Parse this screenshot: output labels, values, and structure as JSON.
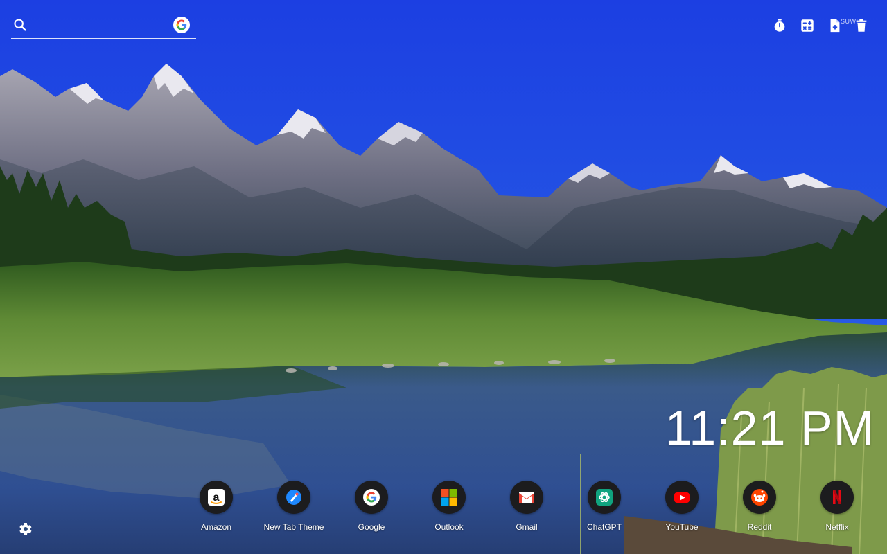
{
  "search": {
    "value": "",
    "placeholder": "",
    "engine_icon": "google-g-icon"
  },
  "tools": [
    {
      "name": "timer-icon",
      "label": "Timer"
    },
    {
      "name": "calculator-icon",
      "label": "Calculator"
    },
    {
      "name": "new-note-icon",
      "label": "New note"
    },
    {
      "name": "trash-icon",
      "label": "Trash"
    }
  ],
  "tool_tag": "SUWI",
  "clock": {
    "time": "11:21 PM"
  },
  "shortcuts": [
    {
      "label": "Amazon",
      "icon": "amazon-icon"
    },
    {
      "label": "New Tab Theme",
      "icon": "new-tab-theme-icon"
    },
    {
      "label": "Google",
      "icon": "google-icon"
    },
    {
      "label": "Outlook",
      "icon": "outlook-icon"
    },
    {
      "label": "Gmail",
      "icon": "gmail-icon"
    },
    {
      "label": "ChatGPT",
      "icon": "chatgpt-icon"
    },
    {
      "label": "YouTube",
      "icon": "youtube-icon"
    },
    {
      "label": "Reddit",
      "icon": "reddit-icon"
    },
    {
      "label": "Netflix",
      "icon": "netflix-icon"
    }
  ],
  "settings_icon": "gear-icon",
  "colors": {
    "sky": "#1f47e0",
    "dock_circle": "#1c1c1e",
    "text": "#ffffff"
  }
}
